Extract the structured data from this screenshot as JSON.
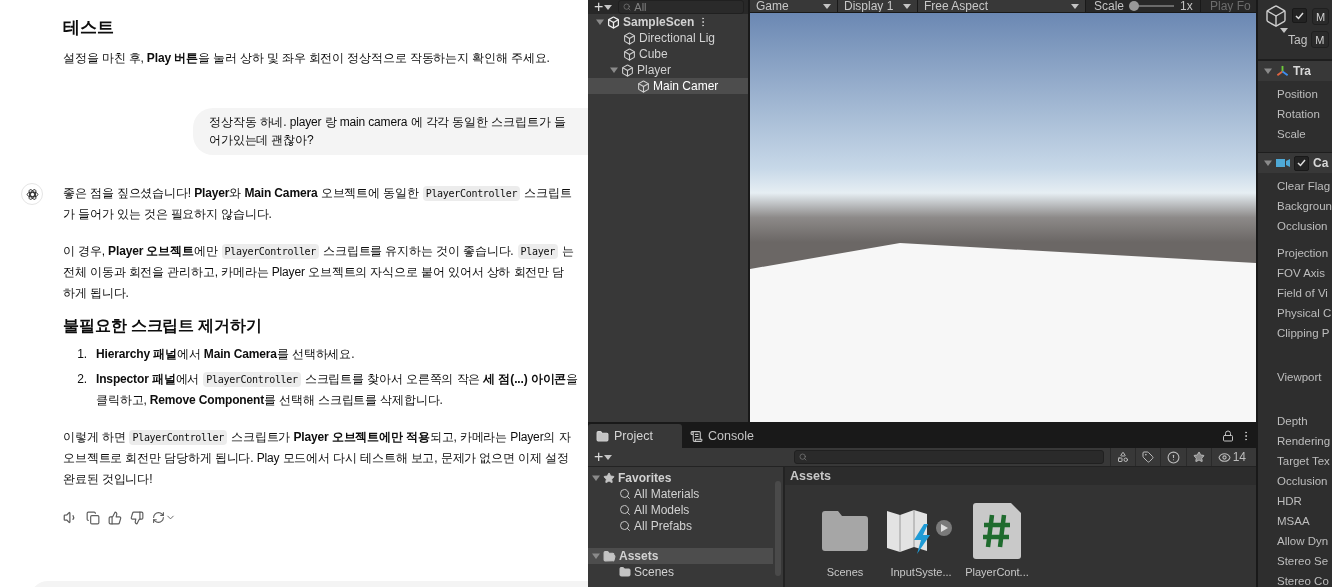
{
  "chat": {
    "intro": [
      {
        "kind": "heading",
        "text": "테스트"
      },
      {
        "kind": "paragraph",
        "lines": [
          [
            {
              "kind": "text",
              "text": "설정을 마친 후, **Play 버튼**을 눌러 상하 및 좌우 회전이 정상적으로 작동하는지 확인해 주세요."
            }
          ]
        ]
      }
    ],
    "user_message": {
      "lines": [
        "정상작동 하네. player 랑 main camera 에 각각 동일한 스크립트가 들",
        "어가있는데 괜찮아?"
      ]
    },
    "reply": [
      {
        "kind": "paragraph",
        "lines": [
          [
            {
              "kind": "text",
              "text": "좋은 점을 짚으셨습니다! **Player**와 **Main Camera** 오브젝트에 동일한"
            },
            {
              "kind": "code",
              "text": "PlayerController"
            },
            {
              "kind": "text",
              "text": "스크립트"
            }
          ],
          [
            {
              "kind": "text",
              "text": "가 들어가 있는 것은 필요하지 않습니다."
            }
          ]
        ]
      },
      {
        "kind": "paragraph",
        "lines": [
          [
            {
              "kind": "text",
              "text": "이 경우, **Player 오브젝트**에만"
            },
            {
              "kind": "code",
              "text": "PlayerController"
            },
            {
              "kind": "text",
              "text": "스크립트를 유지하는 것이 좋습니다."
            },
            {
              "kind": "code",
              "text": "Player"
            },
            {
              "kind": "text",
              "text": "는"
            }
          ],
          [
            {
              "kind": "text",
              "text": "전체 이동과 회전을 관리하고, 카메라는 Player 오브젝트의 자식으로 붙어 있어서 상하 회전만 담"
            }
          ],
          [
            {
              "kind": "text",
              "text": "하게 됩니다."
            }
          ]
        ]
      },
      {
        "kind": "heading",
        "text": "불필요한 스크립트 제거하기"
      },
      {
        "kind": "list",
        "items": [
          {
            "number": "1.",
            "lines": [
              [
                {
                  "kind": "text",
                  "text": "**Hierarchy 패널**에서 **Main Camera**를 선택하세요."
                }
              ]
            ]
          },
          {
            "number": "2.",
            "lines": [
              [
                {
                  "kind": "text",
                  "text": "**Inspector 패널**에서"
                },
                {
                  "kind": "code",
                  "text": "PlayerController"
                },
                {
                  "kind": "text",
                  "text": "스크립트를 찾아서 오른쪽의 작은 **세 점(...) 아이콘**을"
                }
              ],
              [
                {
                  "kind": "text",
                  "text": "클릭하고, **Remove Component**를 선택해 스크립트를 삭제합니다."
                }
              ]
            ]
          }
        ]
      },
      {
        "kind": "paragraph",
        "lines": [
          [
            {
              "kind": "text",
              "text": "이렇게 하면"
            },
            {
              "kind": "code",
              "text": "PlayerController"
            },
            {
              "kind": "text",
              "text": "스크립트가 **Player 오브젝트에만 적용**되고, 카메라는 Player의 자"
            }
          ],
          [
            {
              "kind": "text",
              "text": "오브젝트로 회전만 담당하게 됩니다. Play 모드에서 다시 테스트해 보고, 문제가 없으면 이제 설정"
            }
          ],
          [
            {
              "kind": "text",
              "text": "완료된 것입니다!"
            }
          ]
        ]
      }
    ]
  },
  "hierarchy": {
    "add_button": "+",
    "search_placeholder": "All",
    "tree": [
      {
        "label": "SampleScen",
        "kind": "scene",
        "expanded": true,
        "selected": false,
        "children": [
          {
            "label": "Directional Lig",
            "kind": "object",
            "selected": false
          },
          {
            "label": "Cube",
            "kind": "object",
            "selected": false
          },
          {
            "label": "Player",
            "kind": "object",
            "expanded": true,
            "selected": false,
            "children": [
              {
                "label": "Main Camer",
                "kind": "object",
                "selected": true
              }
            ]
          }
        ]
      }
    ]
  },
  "game_view": {
    "tab": "Game",
    "display": "Display 1",
    "aspect": "Free Aspect",
    "scale_label": "Scale",
    "scale": {
      "level": 0.08
    },
    "scale_reading": "1x",
    "play_focus": "Play Fo"
  },
  "inspector": {
    "header": {
      "active": true,
      "name_field": "M",
      "tag_label": "Tag",
      "tag_field": "M"
    },
    "components": [
      {
        "kind": "transform",
        "title": "Tra",
        "expanded": true,
        "fields": [
          {
            "label": "Position",
            "kind": "field"
          },
          {
            "label": "Rotation",
            "kind": "field"
          },
          {
            "label": "Scale",
            "kind": "field"
          }
        ]
      },
      {
        "kind": "camera",
        "title": "Ca",
        "expanded": true,
        "enabled": true,
        "fields": [
          {
            "label": "Clear Flag",
            "kind": "field"
          },
          {
            "label": "Backgroun",
            "kind": "field"
          },
          {
            "label": "Occlusion",
            "kind": "field"
          },
          {
            "label": "Projection",
            "kind": "header"
          },
          {
            "label": "FOV Axis",
            "kind": "field"
          },
          {
            "label": "Field of Vi",
            "kind": "field"
          },
          {
            "label": "Physical C",
            "kind": "field"
          },
          {
            "label": "Clipping P",
            "kind": "tall"
          },
          {
            "label": "Viewport",
            "kind": "tall"
          },
          {
            "label": "Depth",
            "kind": "field"
          },
          {
            "label": "Rendering",
            "kind": "field"
          },
          {
            "label": "Target Tex",
            "kind": "field"
          },
          {
            "label": "Occlusion",
            "kind": "field"
          },
          {
            "label": "HDR",
            "kind": "field"
          },
          {
            "label": "MSAA",
            "kind": "field"
          },
          {
            "label": "Allow Dyn",
            "kind": "field"
          },
          {
            "label": "Stereo Se",
            "kind": "field"
          },
          {
            "label": "Stereo Co",
            "kind": "field"
          }
        ]
      }
    ]
  },
  "project": {
    "tabs": [
      {
        "label": "Project",
        "kind": "project",
        "selected": true
      },
      {
        "label": "Console",
        "kind": "console",
        "selected": false
      }
    ],
    "add_button": "+",
    "hidden_count": "14",
    "tree": [
      {
        "label": "Favorites",
        "kind": "favorites",
        "expanded": true,
        "selected": false,
        "children": [
          {
            "label": "All Materials",
            "kind": "search",
            "selected": false
          },
          {
            "label": "All Models",
            "kind": "search",
            "selected": false
          },
          {
            "label": "All Prefabs",
            "kind": "search",
            "selected": false
          }
        ]
      },
      {
        "label": "Assets",
        "kind": "folder",
        "expanded": true,
        "selected": true,
        "children": [
          {
            "label": "Scenes",
            "kind": "folder",
            "selected": false
          }
        ]
      }
    ],
    "breadcrumb": "Assets",
    "assets": [
      {
        "label": "Scenes",
        "kind": "folder"
      },
      {
        "label": "InputSyste...",
        "kind": "input-actions"
      },
      {
        "label": "PlayerCont...",
        "kind": "script"
      }
    ]
  }
}
